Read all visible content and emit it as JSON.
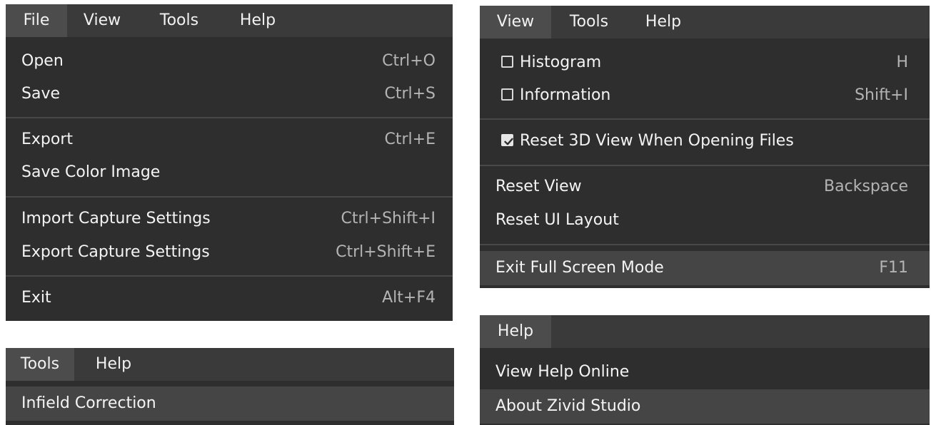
{
  "file_panel": {
    "menubar": [
      "File",
      "View",
      "Tools",
      "Help"
    ],
    "items": [
      {
        "label": "Open",
        "shortcut": "Ctrl+O"
      },
      {
        "label": "Save",
        "shortcut": "Ctrl+S"
      },
      {
        "label": "Export",
        "shortcut": "Ctrl+E"
      },
      {
        "label": "Save Color Image",
        "shortcut": ""
      },
      {
        "label": "Import Capture Settings",
        "shortcut": "Ctrl+Shift+I"
      },
      {
        "label": "Export Capture Settings",
        "shortcut": "Ctrl+Shift+E"
      },
      {
        "label": "Exit",
        "shortcut": "Alt+F4"
      }
    ]
  },
  "view_panel": {
    "menubar": [
      "View",
      "Tools",
      "Help"
    ],
    "items": [
      {
        "label": "Histogram",
        "shortcut": "H",
        "checked": false
      },
      {
        "label": "Information",
        "shortcut": "Shift+I",
        "checked": false
      },
      {
        "label": "Reset 3D View When Opening Files",
        "shortcut": "",
        "checked": true
      },
      {
        "label": "Reset View",
        "shortcut": "Backspace"
      },
      {
        "label": "Reset UI Layout",
        "shortcut": ""
      },
      {
        "label": "Exit Full Screen Mode",
        "shortcut": "F11"
      }
    ]
  },
  "tools_panel": {
    "menubar": [
      "Tools",
      "Help"
    ],
    "items": [
      {
        "label": "Infield Correction"
      }
    ]
  },
  "help_panel": {
    "menubar": [
      "Help"
    ],
    "items": [
      {
        "label": "View Help Online"
      },
      {
        "label": "About Zivid Studio"
      }
    ]
  },
  "colors": {
    "menu_bg": "#2e2e2e",
    "menubar_bg": "#3a3a3a",
    "active_menu_bg": "#4c4c4c",
    "highlight_bg": "#454545",
    "shortcut_text": "#b4b4b4"
  }
}
